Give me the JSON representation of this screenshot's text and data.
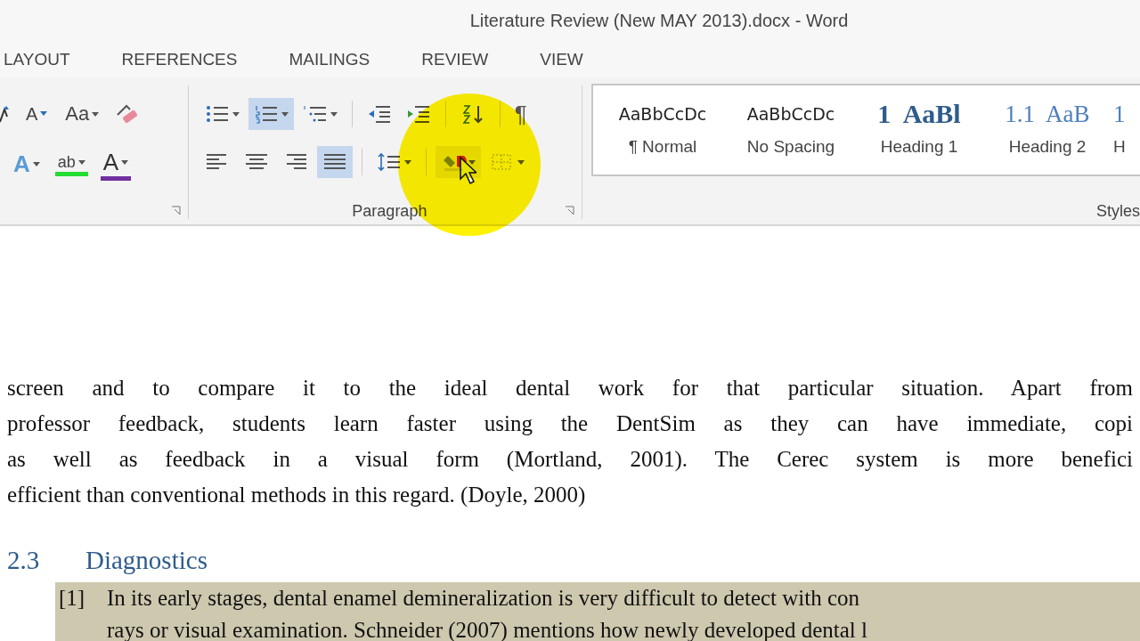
{
  "window": {
    "title": "Literature Review (New MAY 2013).docx - Word"
  },
  "tabs": [
    {
      "label": "LAYOUT",
      "selected": false
    },
    {
      "label": "REFERENCES",
      "selected": false
    },
    {
      "label": "MAILINGS",
      "selected": false
    },
    {
      "label": "REVIEW",
      "selected": false
    },
    {
      "label": "VIEW",
      "selected": false
    }
  ],
  "font_group": {
    "row1": [
      {
        "kind": "grow"
      },
      {
        "kind": "shrink",
        "label": "A"
      },
      {
        "kind": "case",
        "label": "Aa"
      },
      {
        "kind": "clear"
      }
    ],
    "row2": [
      {
        "kind": "effects",
        "label": "A"
      },
      {
        "kind": "highlight",
        "label": "ab"
      },
      {
        "kind": "color",
        "label": "A"
      }
    ]
  },
  "paragraph_group": {
    "label": "Paragraph",
    "row1": [
      {
        "kind": "bullets",
        "selected": false
      },
      {
        "kind": "numbering",
        "selected": true
      },
      {
        "kind": "multilevel",
        "selected": false
      },
      {
        "kind": "sep"
      },
      {
        "kind": "outdent",
        "selected": false
      },
      {
        "kind": "indent",
        "selected": false
      },
      {
        "kind": "sep"
      },
      {
        "kind": "sort",
        "selected": false
      },
      {
        "kind": "sep"
      },
      {
        "kind": "pilcrow",
        "label": "¶",
        "selected": false
      }
    ],
    "row2": [
      {
        "kind": "left",
        "selected": false
      },
      {
        "kind": "center",
        "selected": false
      },
      {
        "kind": "right",
        "selected": false
      },
      {
        "kind": "justify",
        "selected": true
      },
      {
        "kind": "sep"
      },
      {
        "kind": "spacing",
        "selected": false
      },
      {
        "kind": "sep"
      },
      {
        "kind": "shading",
        "selected": false,
        "hover": true
      },
      {
        "kind": "borders",
        "selected": false
      }
    ]
  },
  "styles_group": {
    "label": "Styles",
    "items": [
      {
        "kind": "normal",
        "preview": "AaBbCcDc",
        "name": "¶ Normal"
      },
      {
        "kind": "nospacing",
        "preview": "AaBbCcDc",
        "name": "No Spacing"
      },
      {
        "kind": "heading1",
        "preview": "1  AaBl",
        "name": "Heading 1"
      },
      {
        "kind": "heading2",
        "preview": "1.1  AaB",
        "name": "Heading 2"
      },
      {
        "kind": "heading3",
        "preview": "1",
        "name": "H"
      }
    ]
  },
  "document": {
    "lines": [
      "screen and to compare it to the ideal dental work for that particular situation. Apart from",
      "professor feedback, students learn faster using the DentSim as they can have immediate, copi",
      "as well as feedback in a visual form (Mortland, 2001). The Cerec system is more benefici",
      "efficient than conventional methods in this regard. (Doyle, 2000)"
    ],
    "heading": {
      "number": "2.3",
      "title": "Diagnostics"
    },
    "reference": {
      "marker": "[1]",
      "lines": [
        "In its early stages, dental enamel demineralization is very difficult to detect with con",
        "rays or visual examination. Schneider (2007) mentions how newly developed dental l"
      ]
    }
  }
}
